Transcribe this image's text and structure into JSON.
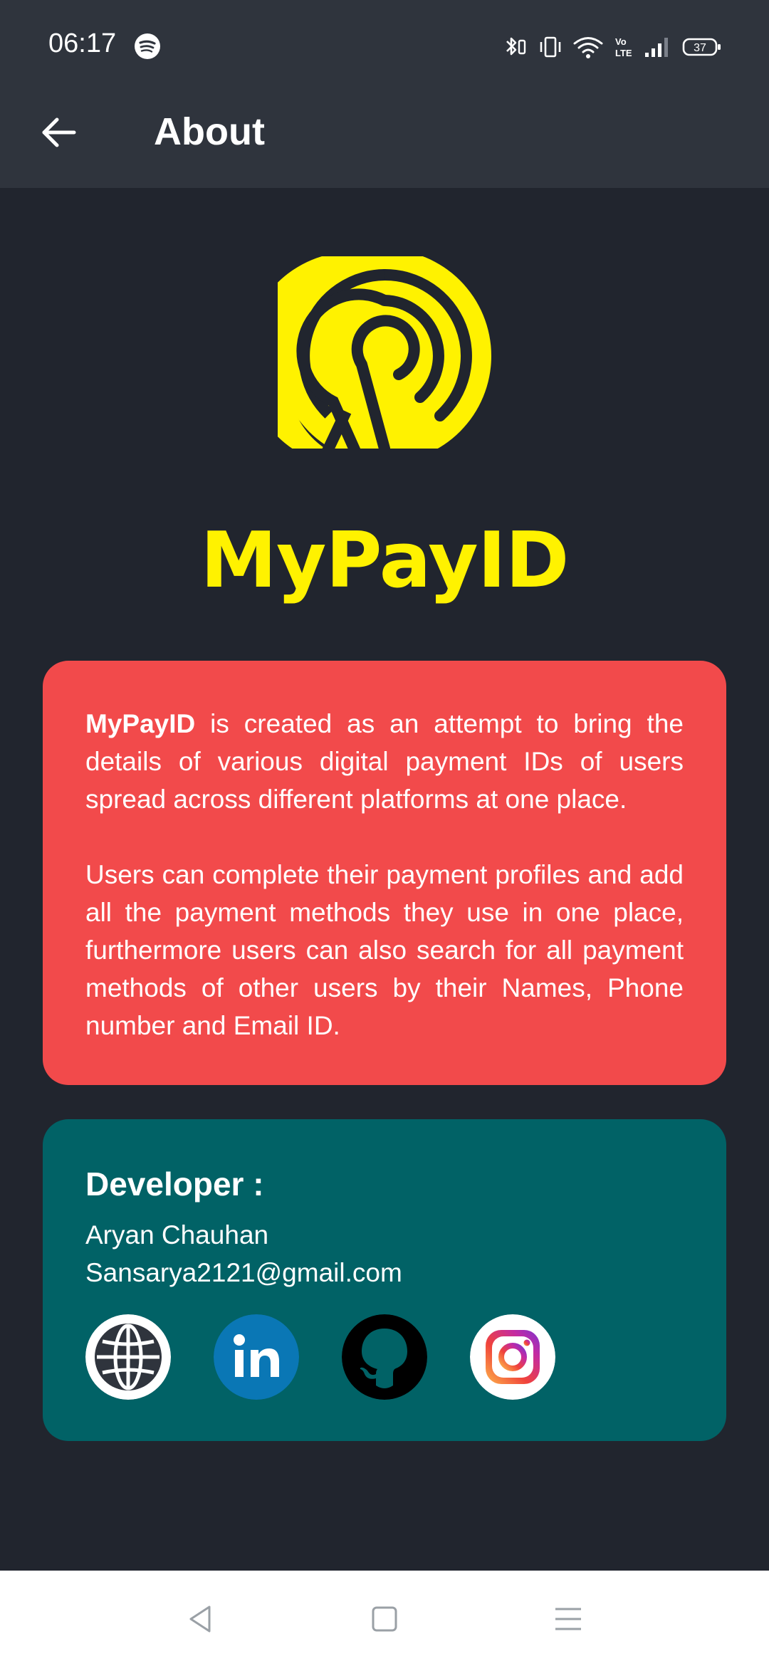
{
  "status_bar": {
    "time": "06:17",
    "battery_level": "37",
    "icons": [
      "spotify-icon",
      "bluetooth-icon",
      "vibrate-icon",
      "wifi-icon",
      "volte-icon",
      "signal-icon",
      "battery-icon"
    ]
  },
  "app_bar": {
    "back_icon": "arrow-left-icon",
    "title": "About"
  },
  "brand": {
    "name": "MyPayID",
    "logo_color": "#fff200"
  },
  "about_card": {
    "background": "#f24a4b",
    "intro_bold": "MyPayID",
    "intro_rest": " is created as an attempt to bring the details of various digital payment IDs of users spread across different platforms at one place.",
    "paragraph2": "Users can complete their payment profiles and add all the payment methods they use in one place, furthermore users can also search for all payment methods of other users by their Names, Phone number and Email ID."
  },
  "developer_card": {
    "background": "#016266",
    "heading": "Developer :",
    "name": "Aryan Chauhan",
    "email": "Sansarya2121@gmail.com",
    "links": [
      "globe-icon",
      "linkedin-icon",
      "github-icon",
      "instagram-icon"
    ]
  },
  "nav_bar": {
    "buttons": [
      "back-triangle-icon",
      "home-square-icon",
      "menu-lines-icon"
    ]
  }
}
